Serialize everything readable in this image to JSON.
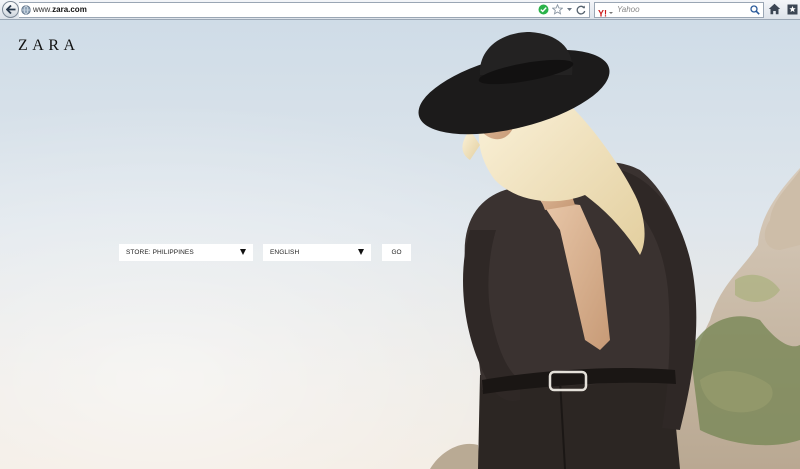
{
  "browser": {
    "url_prefix": "www.",
    "url_domain": "zara.com",
    "search_placeholder": "Yahoo",
    "search_engine_label": "Y!"
  },
  "page": {
    "logo": "ZARA",
    "store_select": {
      "label": "STORE: PHILIPPINES"
    },
    "language_select": {
      "label": "ENGLISH"
    },
    "go_button": "GO"
  },
  "icons": {
    "back": "back-arrow-icon",
    "site": "globe-icon",
    "verified": "check-circle-icon",
    "bookmark_star": "star-icon",
    "dropdown": "chevron-down-icon",
    "refresh": "refresh-icon",
    "search": "magnifier-icon",
    "home": "home-icon",
    "bookmarks": "bookmark-icon"
  },
  "colors": {
    "accent_check": "#2bb34a",
    "yahoo_red": "#cc1a1a",
    "logo": "#111111"
  }
}
